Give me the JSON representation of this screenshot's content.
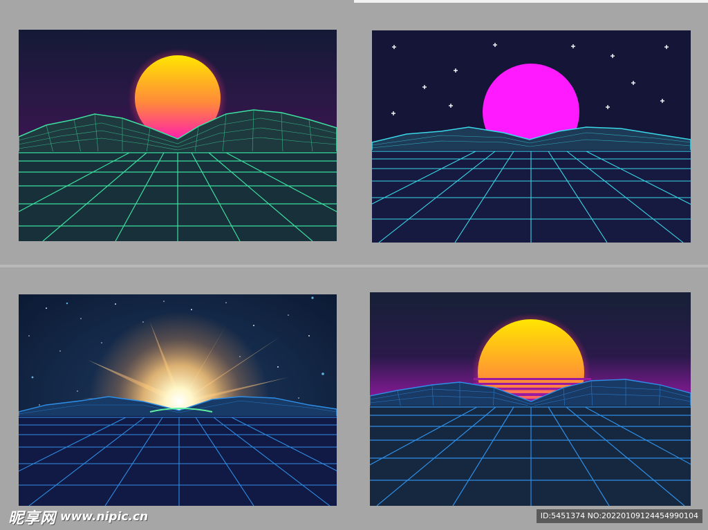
{
  "watermark": {
    "brand": "昵享网",
    "url": "www.nipic.cn"
  },
  "id_label": "ID:5451374 NO:20220109124454990104",
  "colors": {
    "page_bg": "#a6a6a6",
    "sun_yellow": "#ffe600",
    "sun_pink": "#ff1ab3",
    "magenta": "#ff1aff",
    "wire_green": "#3de0a0",
    "wire_cyan": "#3ad8e8",
    "wire_blue": "#2e8fe8",
    "night_navy": "#151537"
  },
  "panels": [
    {
      "id": "panel-sunset-green-wireframe"
    },
    {
      "id": "panel-magenta-sun-stars"
    },
    {
      "id": "panel-sunburst-space"
    },
    {
      "id": "panel-striped-sun"
    }
  ]
}
